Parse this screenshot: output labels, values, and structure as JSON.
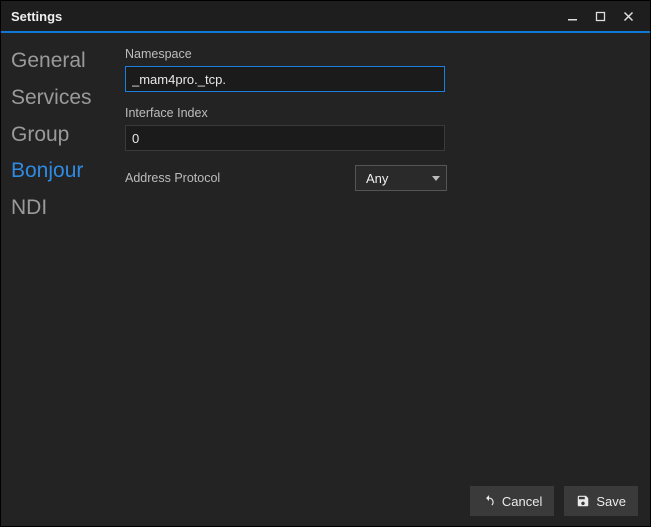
{
  "window": {
    "title": "Settings"
  },
  "sidebar": {
    "items": [
      {
        "label": "General",
        "active": false
      },
      {
        "label": "Services",
        "active": false
      },
      {
        "label": "Group",
        "active": false
      },
      {
        "label": "Bonjour",
        "active": true
      },
      {
        "label": "NDI",
        "active": false
      }
    ]
  },
  "form": {
    "namespace_label": "Namespace",
    "namespace_value": "_mam4pro._tcp.",
    "interface_index_label": "Interface Index",
    "interface_index_value": "0",
    "address_protocol_label": "Address Protocol",
    "address_protocol_value": "Any"
  },
  "footer": {
    "cancel_label": "Cancel",
    "save_label": "Save"
  }
}
